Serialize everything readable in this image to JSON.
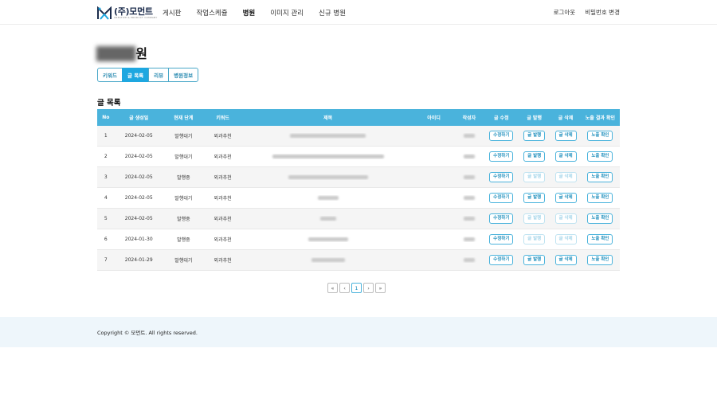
{
  "brand": {
    "logo_text": "(주)모먼트",
    "logo_subtext": "CREATIVE & PRODUCT COMPANY"
  },
  "nav": {
    "items": [
      {
        "label": "게시판",
        "active": false
      },
      {
        "label": "작업스케쥴",
        "active": false
      },
      {
        "label": "병원",
        "active": true
      },
      {
        "label": "이미지 관리",
        "active": false
      },
      {
        "label": "신규 병원",
        "active": false
      }
    ],
    "logout": "로그아웃",
    "change_password": "비밀번호 변경"
  },
  "page": {
    "title_visible": "원",
    "section_title": "글 목록"
  },
  "tabs": [
    {
      "label": "키워드",
      "active": false
    },
    {
      "label": "글 목록",
      "active": true
    },
    {
      "label": "리뷰",
      "active": false
    },
    {
      "label": "병원정보",
      "active": false
    }
  ],
  "table": {
    "headers": [
      "No",
      "글 생성일",
      "현재 단계",
      "키워드",
      "제목",
      "아이디",
      "작성자",
      "글 수정",
      "글 발행",
      "글 삭제",
      "노출 결과 확인"
    ],
    "button_labels": {
      "edit": "수정하기",
      "publish": "글 발행",
      "delete": "글 삭제",
      "check": "노출 확인"
    },
    "rows": [
      {
        "no": "1",
        "date": "2024-02-05",
        "stage": "발행대기",
        "keyword": "외과추천",
        "publish_enabled": true,
        "delete_enabled": true
      },
      {
        "no": "2",
        "date": "2024-02-05",
        "stage": "발행대기",
        "keyword": "외과추천",
        "publish_enabled": true,
        "delete_enabled": true
      },
      {
        "no": "3",
        "date": "2024-02-05",
        "stage": "발행중",
        "keyword": "외과추천",
        "publish_enabled": false,
        "delete_enabled": false
      },
      {
        "no": "4",
        "date": "2024-02-05",
        "stage": "발행대기",
        "keyword": "외과추천",
        "publish_enabled": true,
        "delete_enabled": true
      },
      {
        "no": "5",
        "date": "2024-02-05",
        "stage": "발행중",
        "keyword": "외과추천",
        "publish_enabled": false,
        "delete_enabled": false
      },
      {
        "no": "6",
        "date": "2024-01-30",
        "stage": "발행중",
        "keyword": "외과추천",
        "publish_enabled": false,
        "delete_enabled": false
      },
      {
        "no": "7",
        "date": "2024-01-29",
        "stage": "발행대기",
        "keyword": "외과추천",
        "publish_enabled": true,
        "delete_enabled": true
      }
    ]
  },
  "pagination": {
    "first": "«",
    "prev": "‹",
    "current": "1",
    "next": "›",
    "last": "»"
  },
  "footer": {
    "copyright": "Copyright © 모먼트. All rights reserved."
  },
  "colors": {
    "accent": "#4ab3dc",
    "tab_active": "#1ea7e0",
    "footer_bg": "#eef6fb"
  }
}
